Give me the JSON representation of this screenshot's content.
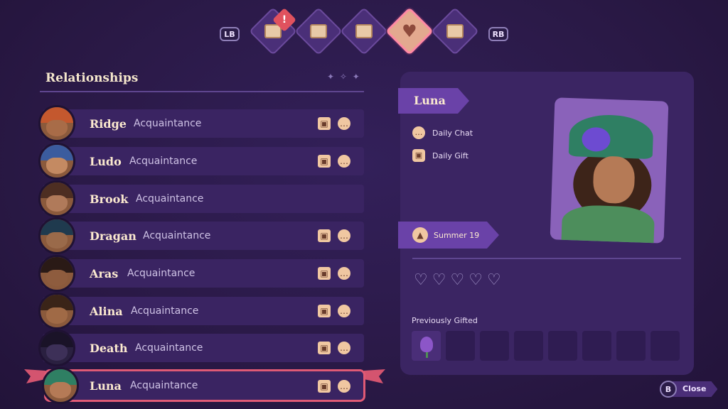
{
  "nav": {
    "left_bumper": "LB",
    "right_bumper": "RB",
    "alert_badge": "!",
    "tabs": [
      {
        "icon": "quests-icon"
      },
      {
        "icon": "map-icon"
      },
      {
        "icon": "calendar-icon"
      },
      {
        "icon": "heart-icon",
        "active": true
      },
      {
        "icon": "journal-icon"
      }
    ],
    "active_glyph": "♥"
  },
  "relationships": {
    "title": "Relationships",
    "title_decoration": "✦ ✧ ✦",
    "rows": [
      {
        "name": "Ridge",
        "status": "Acquaintance",
        "gift": true,
        "chat": true
      },
      {
        "name": "Ludo",
        "status": "Acquaintance",
        "gift": true,
        "chat": true
      },
      {
        "name": "Brook",
        "status": "Acquaintance",
        "gift": false,
        "chat": false
      },
      {
        "name": "Dragan",
        "status": "Acquaintance",
        "gift": true,
        "chat": true
      },
      {
        "name": "Aras",
        "status": "Acquaintance",
        "gift": true,
        "chat": true
      },
      {
        "name": "Alina",
        "status": "Acquaintance",
        "gift": true,
        "chat": true
      },
      {
        "name": "Death",
        "status": "Acquaintance",
        "gift": true,
        "chat": true
      },
      {
        "name": "Luna",
        "status": "Acquaintance",
        "gift": true,
        "chat": true,
        "selected": true
      }
    ]
  },
  "detail": {
    "name": "Luna",
    "daily_chat": "Daily Chat",
    "daily_gift": "Daily Gift",
    "birthday": "Summer 19",
    "hearts_total": 5,
    "hearts_filled": 0,
    "previously_gifted_label": "Previously Gifted",
    "gift_slots": 8,
    "gifted_items": [
      "tulip-icon"
    ]
  },
  "footer": {
    "close_button": "B",
    "close_label": "Close"
  },
  "colors": {
    "background": "#2c1b47",
    "panel": "#3b2563",
    "accent": "#6a42a8",
    "selection": "#e05a75"
  }
}
